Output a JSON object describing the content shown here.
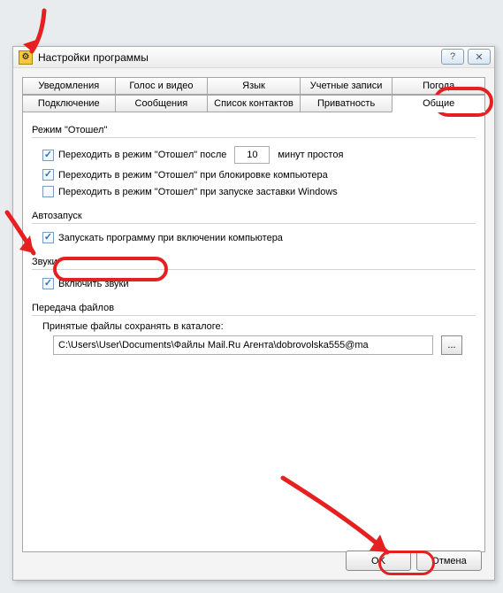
{
  "window_title": "Настройки программы",
  "title_buttons": {
    "help": "?",
    "close": "✕"
  },
  "tabs_row1": [
    "Уведомления",
    "Голос и видео",
    "Язык",
    "Учетные записи",
    "Погода"
  ],
  "tabs_row2": [
    "Подключение",
    "Сообщения",
    "Список контактов",
    "Приватность",
    "Общие"
  ],
  "active_tab": "Общие",
  "away_group": {
    "label": "Режим \"Отошел\"",
    "row1_before": "Переходить в режим \"Отошел\" после",
    "row1_value": "10",
    "row1_after": "минут простоя",
    "row2": "Переходить в режим \"Отошел\" при блокировке компьютера",
    "row3": "Переходить в режим \"Отошел\" при запуске заставки Windows"
  },
  "autorun_group": {
    "label": "Автозапуск",
    "row1": "Запускать программу при включении компьютера"
  },
  "sounds_group": {
    "label": "Звуки",
    "row1": "Включить звуки"
  },
  "files_group": {
    "label": "Передача файлов",
    "sublabel": "Принятые файлы сохранять в каталоге:",
    "path": "C:\\Users\\User\\Documents\\Файлы Mail.Ru Агента\\dobrovolska555@ma",
    "browse": "..."
  },
  "dialog_buttons": {
    "ok": "OK",
    "cancel": "Отмена"
  }
}
